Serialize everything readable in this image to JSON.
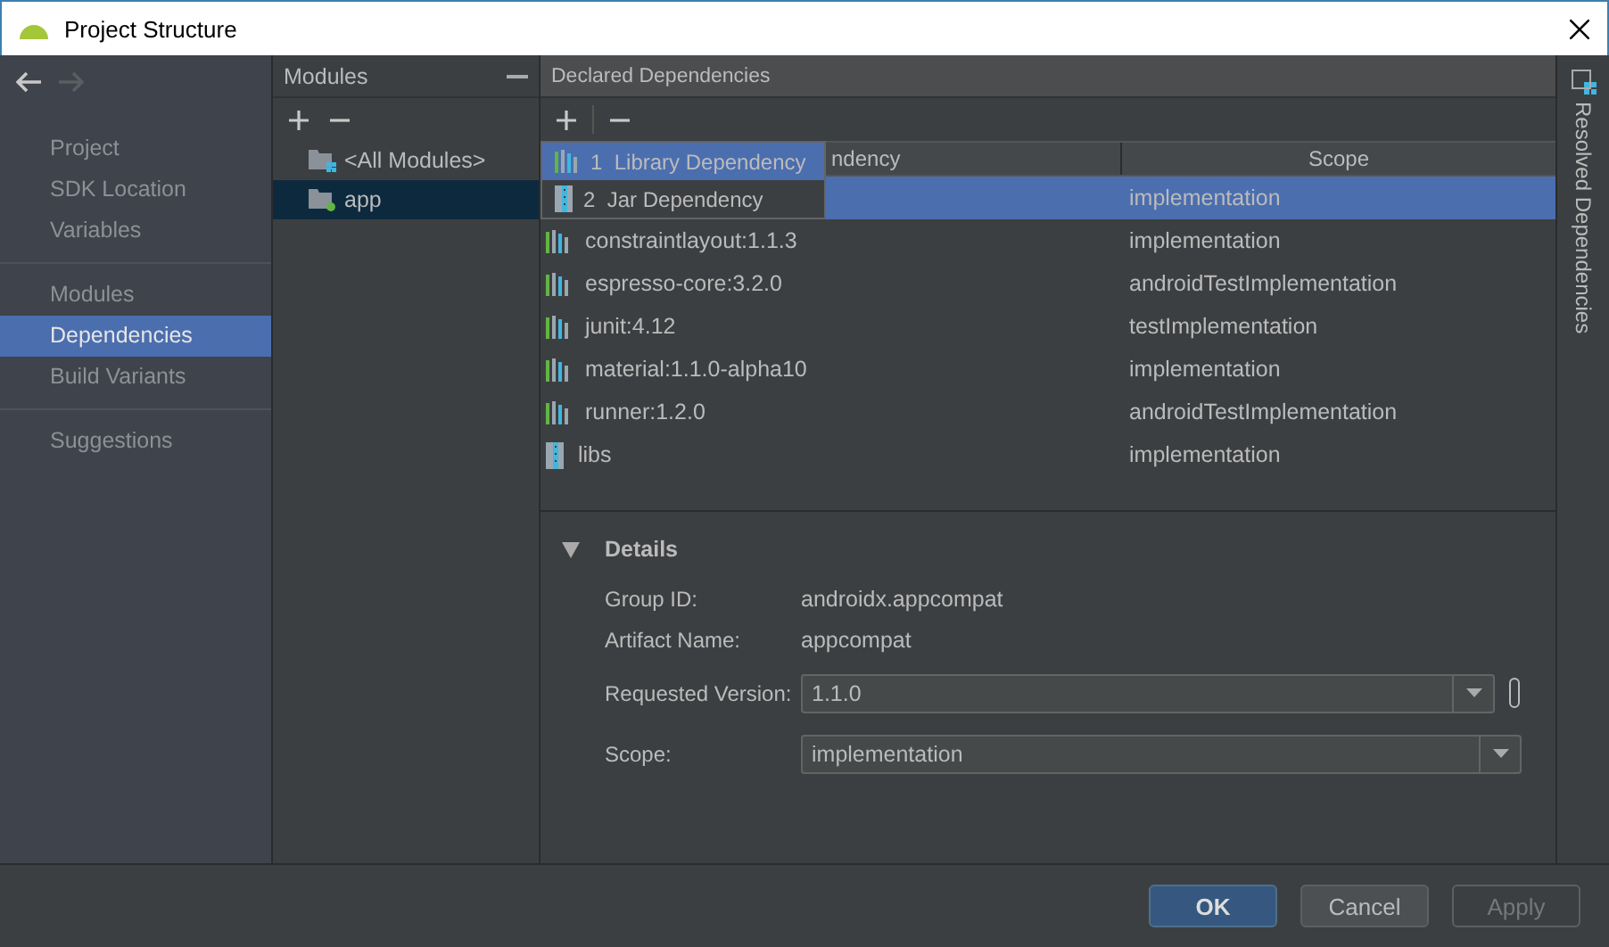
{
  "window": {
    "title": "Project Structure"
  },
  "navigation": [
    {
      "kind": "back",
      "disabled": false
    },
    {
      "kind": "forward",
      "disabled": true
    }
  ],
  "sidebar": {
    "sections": [
      {
        "items": [
          {
            "label": "Project",
            "selected": false
          },
          {
            "label": "SDK Location",
            "selected": false
          },
          {
            "label": "Variables",
            "selected": false
          }
        ]
      },
      {
        "items": [
          {
            "label": "Modules",
            "selected": false
          },
          {
            "label": "Dependencies",
            "selected": true
          },
          {
            "label": "Build Variants",
            "selected": false
          }
        ]
      },
      {
        "items": [
          {
            "label": "Suggestions",
            "selected": false
          }
        ]
      }
    ]
  },
  "modules": {
    "title": "Modules",
    "items": [
      {
        "label": "<All Modules>",
        "kind": "all",
        "selected": false
      },
      {
        "label": "app",
        "kind": "module",
        "selected": true
      }
    ]
  },
  "dependencies": {
    "title": "Declared Dependencies",
    "columns": [
      "ndency",
      "Scope"
    ],
    "add_menu": {
      "items": [
        {
          "number": "1",
          "label": "Library Dependency",
          "kind": "library",
          "selected": true
        },
        {
          "number": "2",
          "label": "Jar Dependency",
          "kind": "jar",
          "selected": false
        }
      ]
    },
    "rows": [
      {
        "kind": "hidden",
        "scope": "implementation",
        "selected": true
      },
      {
        "kind": "library",
        "name": "constraintlayout:1.1.3",
        "scope": "implementation",
        "selected": false
      },
      {
        "kind": "library",
        "name": "espresso-core:3.2.0",
        "scope": "androidTestImplementation",
        "selected": false
      },
      {
        "kind": "library",
        "name": "junit:4.12",
        "scope": "testImplementation",
        "selected": false
      },
      {
        "kind": "library",
        "name": "material:1.1.0-alpha10",
        "scope": "implementation",
        "selected": false
      },
      {
        "kind": "library",
        "name": "runner:1.2.0",
        "scope": "androidTestImplementation",
        "selected": false
      },
      {
        "kind": "jar",
        "name": "libs",
        "scope": "implementation",
        "selected": false
      }
    ]
  },
  "details": {
    "title": "Details",
    "expanded": true,
    "fields": [
      {
        "kind": "text",
        "label": "Group ID:",
        "value": "androidx.appcompat"
      },
      {
        "kind": "text",
        "label": "Artifact Name:",
        "value": "appcompat"
      },
      {
        "kind": "version_combo",
        "label": "Requested Version:",
        "value": "1.1.0"
      },
      {
        "kind": "combo",
        "label": "Scope:",
        "value": "implementation"
      }
    ]
  },
  "side_tab": {
    "label": "Resolved Dependencies"
  },
  "buttons": [
    {
      "label": "OK",
      "kind": "default",
      "disabled": false
    },
    {
      "label": "Cancel",
      "kind": "normal",
      "disabled": false
    },
    {
      "label": "Apply",
      "kind": "normal",
      "disabled": true
    }
  ]
}
